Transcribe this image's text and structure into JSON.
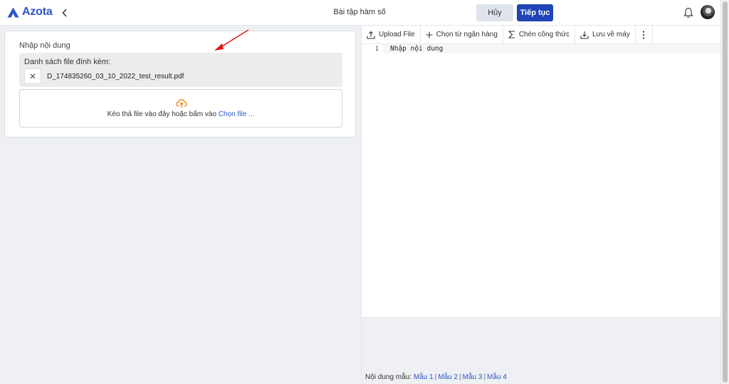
{
  "header": {
    "logo_text": "Azota",
    "title": "Bài tập hàm số",
    "cancel_label": "Hủy",
    "continue_label": "Tiếp tục"
  },
  "colors": {
    "brand": "#2b56c6",
    "primary_button": "#1f44b5",
    "upload_icon": "#f07c00",
    "annotation_arrow": "#e01a1a"
  },
  "left": {
    "field_label": "Nhập nội dung",
    "attachments_title": "Danh sách file đính kèm:",
    "file_name": "D_174835260_03_10_2022_test_result.pdf",
    "dropzone_text": "Kéo thả file vào đây hoặc bấm vào",
    "dropzone_link": "Chọn file ..."
  },
  "toolbar": {
    "upload_label": "Upload File",
    "bank_label": "Chọn từ ngân hàng",
    "formula_label": "Chèn công thức",
    "save_label": "Lưu về máy"
  },
  "editor": {
    "line_number": "1",
    "placeholder": "Nhập nội dung"
  },
  "samples": {
    "label": "Nội dung mẫu:",
    "items": [
      "Mẫu 1",
      "Mẫu 2",
      "Mẫu 3",
      "Mẫu 4"
    ]
  }
}
